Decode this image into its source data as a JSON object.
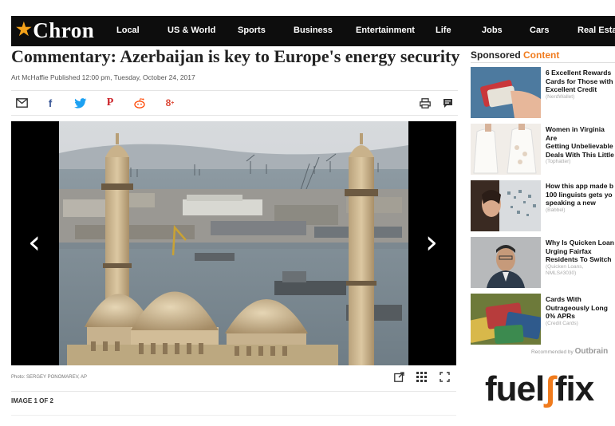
{
  "site": {
    "logo": "Chron",
    "logo_star_icon": "star-icon",
    "nav": [
      "Local",
      "US & World",
      "Sports",
      "Business",
      "Entertainment",
      "Life",
      "Jobs",
      "Cars",
      "Real Estate"
    ]
  },
  "article": {
    "headline": "Commentary: Azerbaijan is key to Europe's energy security",
    "byline": "Art McHaffie  Published 12:00 pm, Tuesday, October 24, 2017",
    "share_icons": [
      "email-icon",
      "facebook-icon",
      "twitter-icon",
      "pinterest-icon",
      "reddit-icon",
      "google-plus-icon"
    ],
    "tool_icons": [
      "print-icon",
      "comment-icon"
    ]
  },
  "gallery": {
    "caption": "Photo: SERGEY PONOMAREV, AP",
    "image_count": "IMAGE 1 OF 2",
    "prev_icon": "chevron-left-icon",
    "next_icon": "chevron-right-icon",
    "tools": [
      "expand-icon",
      "grid-icon",
      "fullscreen-icon"
    ]
  },
  "sponsored": {
    "label_prefix": "Sponsored",
    "label_accent": "Content",
    "items": [
      {
        "title": "6 Excellent Rewards\nCards for Those with\nExcellent Credit",
        "source": "(NerdWallet)"
      },
      {
        "title": "Women in Virginia Are\nGetting Unbelievable\nDeals With This Little",
        "source": "(Tophatter)"
      },
      {
        "title": "How this app made b\n100 linguists gets yo\nspeaking a new",
        "source": "(Babbel)"
      },
      {
        "title": "Why Is Quicken Loan\nUrging Fairfax\nResidents To Switch",
        "source": "(Quicken Loans,\nNMLS#3030)"
      },
      {
        "title": "Cards With\nOutrageously Long\n0% APRs",
        "source": "(Credit Cards)"
      }
    ],
    "recommended_by": "Recommended by",
    "outbrain": "Outbrain"
  },
  "ad": {
    "brand_a": "fuel",
    "brand_b": "fix"
  },
  "colors": {
    "nav_bg": "#0d0d0d",
    "accent": "#f07b1d",
    "twitter": "#1da1f2",
    "facebook": "#3b5998",
    "pinterest": "#cb2027",
    "google": "#dd4b39"
  }
}
